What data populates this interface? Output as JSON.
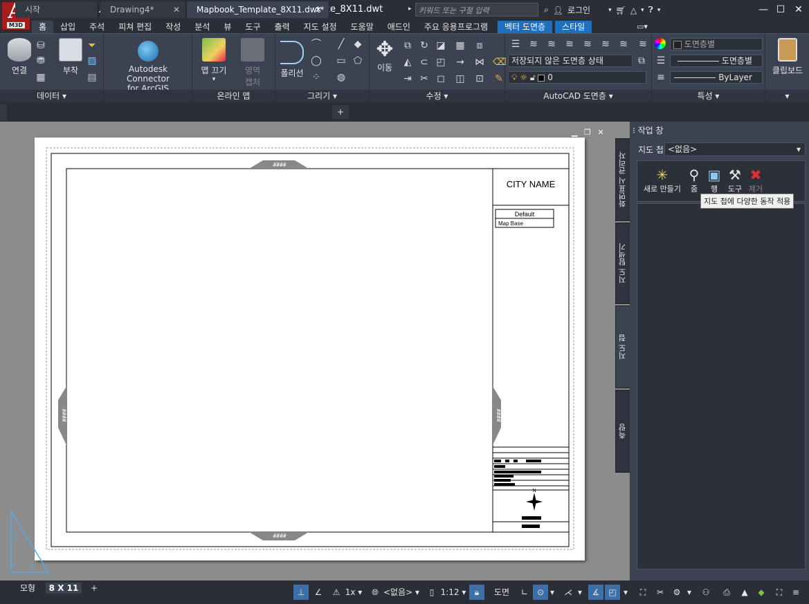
{
  "app": {
    "logo_letter": "A",
    "logo_tag": "M3D",
    "title": "Mapbook_Template_8X11.dwt",
    "search_placeholder": "키워드 또는 구절 입력",
    "login": "로그인"
  },
  "ribbon_tabs": [
    "홈",
    "삽입",
    "주석",
    "피쳐 편집",
    "작성",
    "분석",
    "뷰",
    "도구",
    "출력",
    "지도 설정",
    "도움말",
    "애드인",
    "주요 응용프로그램",
    "벡터 도면층",
    "스타일"
  ],
  "panels": {
    "data": {
      "title": "데이터 ▾",
      "connect": "연결",
      "attach": "부착"
    },
    "arcgis": {
      "label1": "Autodesk Connector",
      "label2": "for ArcGIS"
    },
    "online": {
      "title": "온라인 맵",
      "mapoff": "맵 끄기",
      "capture1": "영역",
      "capture2": "캡처"
    },
    "draw": {
      "title": "그리기 ▾",
      "polyline": "폴리선"
    },
    "modify": {
      "title": "수정 ▾",
      "move": "이동"
    },
    "layers": {
      "title": "AutoCAD 도면층 ▾",
      "state": "저장되지 않은 도면층 상태",
      "layer0": "0"
    },
    "props": {
      "title": "특성 ▾",
      "color": "도면층별",
      "linetype": "도면층별",
      "lineweight": "ByLayer"
    },
    "clip": {
      "label": "클립보드"
    }
  },
  "doc_tabs": [
    "시작",
    "Drawing4*",
    "Mapbook_Template_8X11.dwt*"
  ],
  "drawing": {
    "city": "CITY NAME",
    "legend_default": "Default",
    "legend_base": "Map Base",
    "hashes": "####",
    "north": "N"
  },
  "palette": {
    "header": "작업 창",
    "mapbook_label": "지도 첩",
    "mapbook_value": "<없음>",
    "new": "새로 만들기",
    "zoom": "줌",
    "view": "행",
    "tools": "도구",
    "remove": "제거",
    "tooltip": "지도 첩에 다양한 동작 적용",
    "vtabs": [
      "화면표시 관리자",
      "지도 탐색기",
      "지도 첩",
      "측량"
    ]
  },
  "layout_tabs": [
    "모형",
    "8 X 11"
  ],
  "status": {
    "scale": "1x",
    "coord": "<없음>",
    "ratio": "1:12",
    "paper": "도면"
  }
}
